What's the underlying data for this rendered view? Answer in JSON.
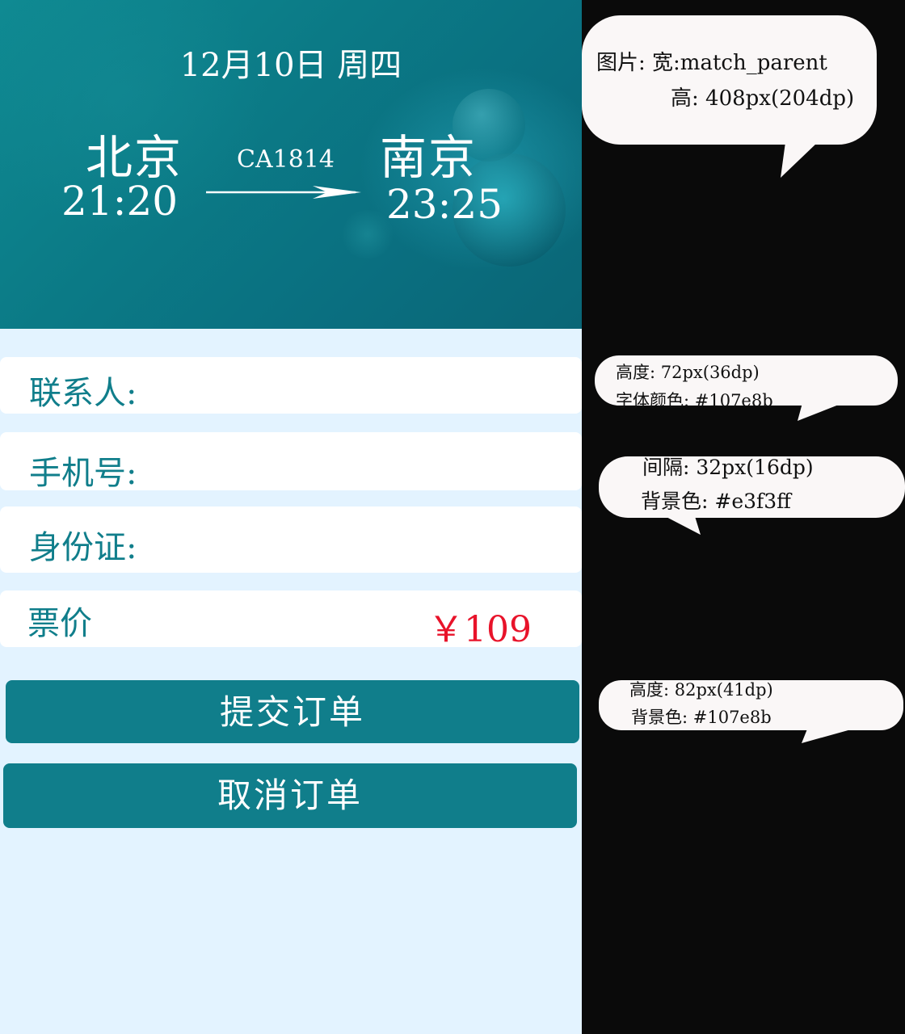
{
  "header": {
    "date": "12月10日  周四",
    "departure": {
      "city": "北京",
      "time": "21:20"
    },
    "flight_number": "CA1814",
    "arrival": {
      "city": "南京",
      "time": "23:25"
    }
  },
  "form": {
    "contact_label": "联系人:",
    "phone_label": "手机号:",
    "id_label": "身份证:",
    "price_label": "票价",
    "price_value": "￥109"
  },
  "buttons": {
    "submit": "提交订单",
    "cancel": "取消订单"
  },
  "annotations": {
    "image": {
      "line1": "图片: 宽:match_parent",
      "line2": "高: 408px(204dp)"
    },
    "field": {
      "line1": "高度: 72px(36dp)",
      "line2": "字体颜色: #107e8b"
    },
    "spacing": {
      "line1": "间隔: 32px(16dp)",
      "line2": "背景色: #e3f3ff"
    },
    "button": {
      "line1": "高度: 82px(41dp)",
      "line2": "背景色: #107e8b"
    }
  },
  "colors": {
    "accent": "#107e8b",
    "background": "#e3f3ff",
    "price": "#e8132a"
  }
}
